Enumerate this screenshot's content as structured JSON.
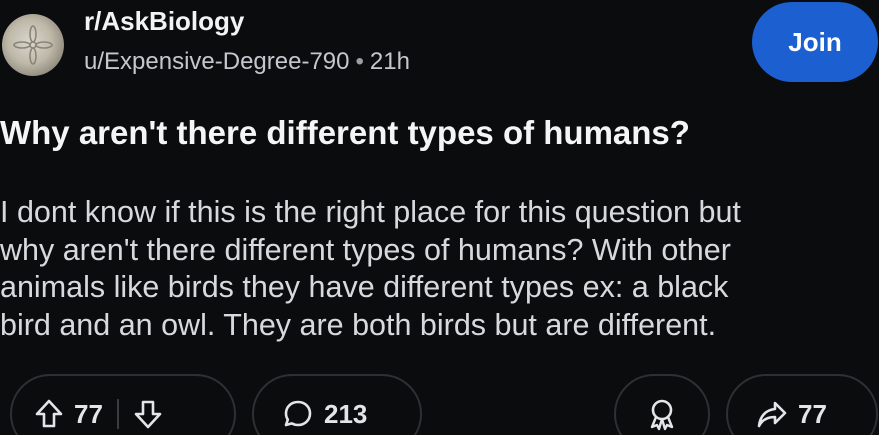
{
  "post": {
    "subreddit": "r/AskBiology",
    "author": "u/Expensive-Degree-790",
    "separator": "•",
    "time": "21h",
    "join_label": "Join",
    "title": "Why aren't there different types of humans?",
    "body_lines": [
      "I dont know if this is the right place for this question but",
      "why aren't there different types of humans? With other",
      "animals like birds they have different types ex: a black",
      "bird and an owl. They are both birds but are different."
    ]
  },
  "actions": {
    "upvotes": "77",
    "comments": "213",
    "shares": "77"
  },
  "icons": {
    "avatar": "sand-dollar-avatar",
    "upvote": "upvote-arrow-icon",
    "downvote": "downvote-arrow-icon",
    "comment": "comment-bubble-icon",
    "award": "award-ribbon-icon",
    "share": "share-arrow-icon"
  },
  "colors": {
    "background": "#0b0c0e",
    "join_button": "#1b5fd1",
    "text": "#e8eaed",
    "muted": "#c4c7cc"
  }
}
